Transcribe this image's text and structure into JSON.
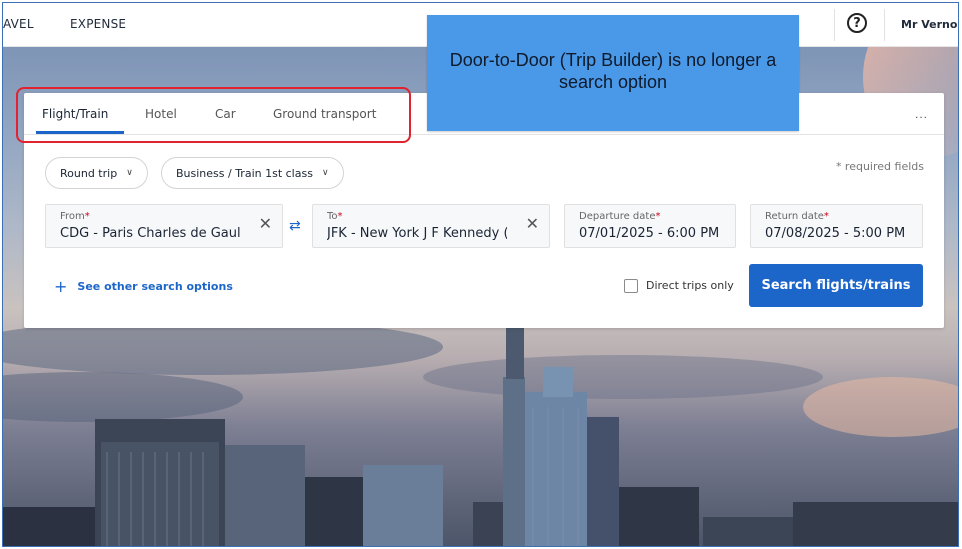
{
  "topnav": {
    "travel_label": "AVEL",
    "expense_label": "EXPENSE",
    "help_label": "?",
    "user_name": "Mr Vernon B"
  },
  "tabs": [
    {
      "label": "Flight/Train",
      "active": true
    },
    {
      "label": "Hotel",
      "active": false
    },
    {
      "label": "Car",
      "active": false
    },
    {
      "label": "Ground transport",
      "active": false
    }
  ],
  "more_menu": "...",
  "trip_type": "Round trip",
  "cabin_class": "Business / Train 1st class",
  "required_note": "* required fields",
  "from": {
    "label": "From",
    "value": "CDG - Paris Charles de Gaulle"
  },
  "to": {
    "label": "To",
    "value": "JFK - New York J F Kennedy (N"
  },
  "departure": {
    "label": "Departure date",
    "value": "07/01/2025 - 6:00 PM"
  },
  "return": {
    "label": "Return date",
    "value": "07/08/2025 - 5:00 PM"
  },
  "required_star": "*",
  "clear_glyph": "✕",
  "swap_glyph": "⇄",
  "chevron_glyph": "∨",
  "plus_glyph": "+",
  "other_options_label": "See other search options",
  "direct_trips_label": "Direct trips only",
  "direct_trips_checked": false,
  "search_button_label": "Search flights/trains",
  "callout_text": "Door-to-Door (Trip Builder) is no longer a search option",
  "colors": {
    "accent": "#1d66c9",
    "callout": "#4a98e8",
    "highlight": "#e0232e",
    "required": "#d0021b"
  },
  "icons": {
    "help": "help-icon",
    "clear": "close-icon",
    "swap": "swap-icon",
    "chevron": "chevron-down-icon",
    "plus": "plus-icon"
  }
}
